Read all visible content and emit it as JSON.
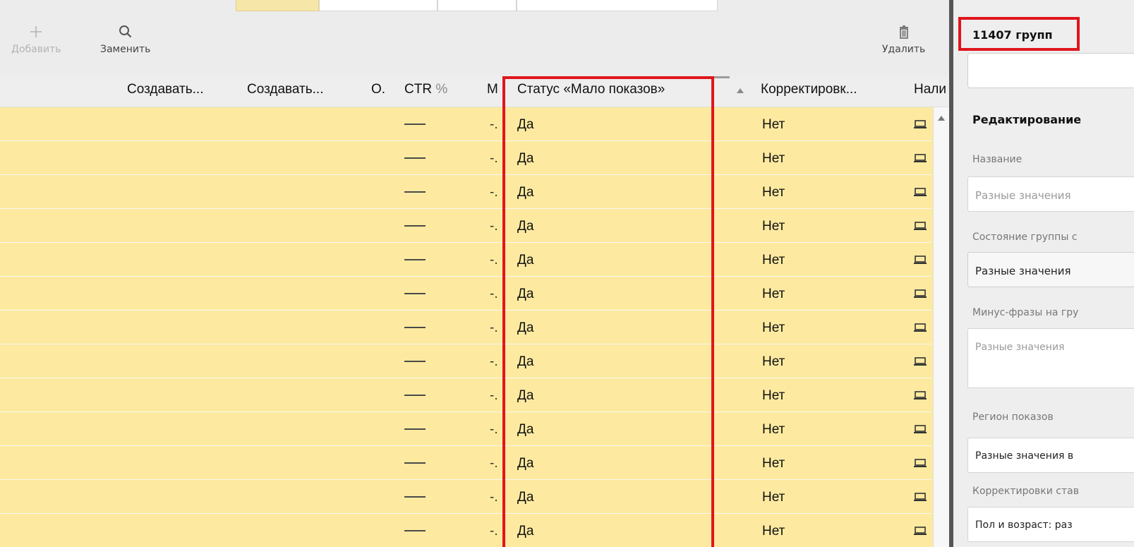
{
  "toolbar": {
    "add_label": "Добавить",
    "replace_label": "Заменить",
    "delete_label": "Удалить",
    "add_icon": "plus-icon",
    "replace_icon": "search-icon",
    "delete_icon": "trash-icon"
  },
  "columns": [
    {
      "label": "Создавать..."
    },
    {
      "label": "Создавать..."
    },
    {
      "label": "О."
    },
    {
      "label": "CTR",
      "unit": "%"
    },
    {
      "label": "М"
    },
    {
      "label": "Статус «Мало показов»",
      "sorted": "asc"
    },
    {
      "label": "Корректировк..."
    },
    {
      "label": "Нали"
    }
  ],
  "rows": [
    {
      "ctr": "—",
      "m": "-.",
      "status": "Да",
      "corr": "Нет",
      "device": "laptop-icon"
    },
    {
      "ctr": "—",
      "m": "-.",
      "status": "Да",
      "corr": "Нет",
      "device": "laptop-icon"
    },
    {
      "ctr": "—",
      "m": "-.",
      "status": "Да",
      "corr": "Нет",
      "device": "laptop-icon"
    },
    {
      "ctr": "—",
      "m": "-.",
      "status": "Да",
      "corr": "Нет",
      "device": "laptop-icon"
    },
    {
      "ctr": "—",
      "m": "-.",
      "status": "Да",
      "corr": "Нет",
      "device": "laptop-icon"
    },
    {
      "ctr": "—",
      "m": "-.",
      "status": "Да",
      "corr": "Нет",
      "device": "laptop-icon"
    },
    {
      "ctr": "—",
      "m": "-.",
      "status": "Да",
      "corr": "Нет",
      "device": "laptop-icon"
    },
    {
      "ctr": "—",
      "m": "-.",
      "status": "Да",
      "corr": "Нет",
      "device": "laptop-icon"
    },
    {
      "ctr": "—",
      "m": "-.",
      "status": "Да",
      "corr": "Нет",
      "device": "laptop-icon"
    },
    {
      "ctr": "—",
      "m": "-.",
      "status": "Да",
      "corr": "Нет",
      "device": "laptop-icon"
    },
    {
      "ctr": "—",
      "m": "-.",
      "status": "Да",
      "corr": "Нет",
      "device": "laptop-icon"
    },
    {
      "ctr": "—",
      "m": "-.",
      "status": "Да",
      "corr": "Нет",
      "device": "laptop-icon"
    },
    {
      "ctr": "—",
      "m": "-.",
      "status": "Да",
      "corr": "Нет",
      "device": "laptop-icon"
    }
  ],
  "panel": {
    "count": "11407 групп",
    "section_title": "Редактирование",
    "fields": {
      "name_label": "Название",
      "name_placeholder": "Разные значения",
      "state_label": "Состояние группы с",
      "state_value": "Разные значения",
      "minus_label": "Минус-фразы на гру",
      "minus_placeholder": "Разные значения",
      "region_label": "Регион показов",
      "region_value": "Разные значения в",
      "bid_label": "Корректировки став",
      "bid_value": "Пол и возраст: раз"
    }
  },
  "colors": {
    "row_highlight": "#fdeaa0",
    "frame_red": "#e0161c",
    "divider": "#555555"
  }
}
